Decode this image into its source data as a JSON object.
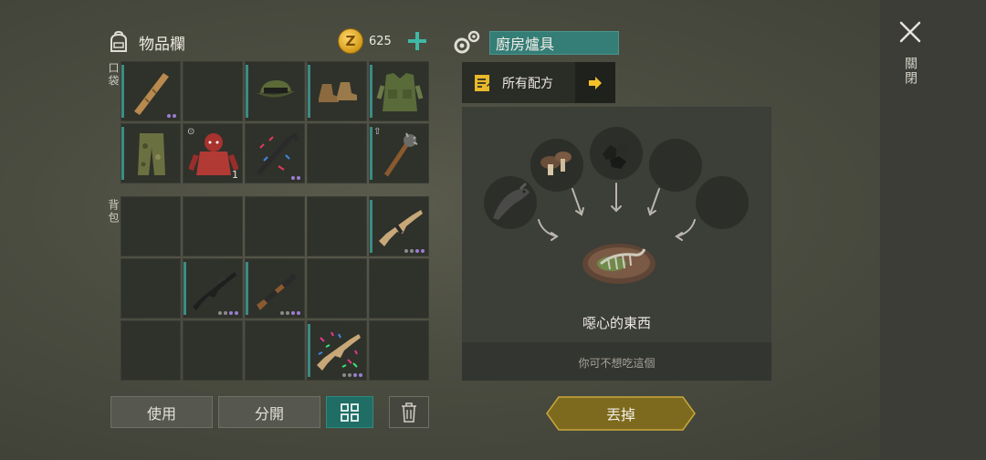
{
  "inventory": {
    "title": "物品欄",
    "coins": "625",
    "pocket_label": "口袋",
    "backpack_label": "背包",
    "pocket_slots": [
      {
        "item": "wooden-plank",
        "dots": 2,
        "bar": true
      },
      {
        "item": "",
        "bar": false
      },
      {
        "item": "cap",
        "bar": true
      },
      {
        "item": "boots",
        "bar": true
      },
      {
        "item": "tactical-vest",
        "bar": true
      },
      {
        "item": "camo-pants",
        "bar": true
      },
      {
        "item": "red-hoodie",
        "qty": "1",
        "bar": false
      },
      {
        "item": "decorated-crowbar",
        "dots": 2,
        "bar": false
      },
      {
        "item": "",
        "bar": false
      },
      {
        "item": "spiked-bat",
        "bar": true
      }
    ],
    "backpack_slots": [
      {
        "item": ""
      },
      {
        "item": ""
      },
      {
        "item": ""
      },
      {
        "item": ""
      },
      {
        "item": "scar-rifle",
        "dots": 4,
        "bar": true
      },
      {
        "item": ""
      },
      {
        "item": "m16-rifle",
        "dots": 4,
        "bar": true
      },
      {
        "item": "shotgun",
        "dots": 4,
        "bar": true
      },
      {
        "item": ""
      },
      {
        "item": ""
      },
      {
        "item": ""
      },
      {
        "item": ""
      },
      {
        "item": ""
      },
      {
        "item": "decorated-rifle",
        "dots": 4,
        "bar": true
      },
      {
        "item": ""
      }
    ]
  },
  "buttons": {
    "use": "使用",
    "split": "分開",
    "discard": "丟掉"
  },
  "crafting": {
    "station": "廚房爐具",
    "all_recipes": "所有配方",
    "result_name": "噁心的東西",
    "result_desc": "你可不想吃這個"
  },
  "close_label": "關閉",
  "colors": {
    "accent_teal": "#357d77",
    "rarity_purple": "#9a7fd0",
    "discard_gold": "#7d6a1e",
    "coin_gold": "#e0a824"
  }
}
